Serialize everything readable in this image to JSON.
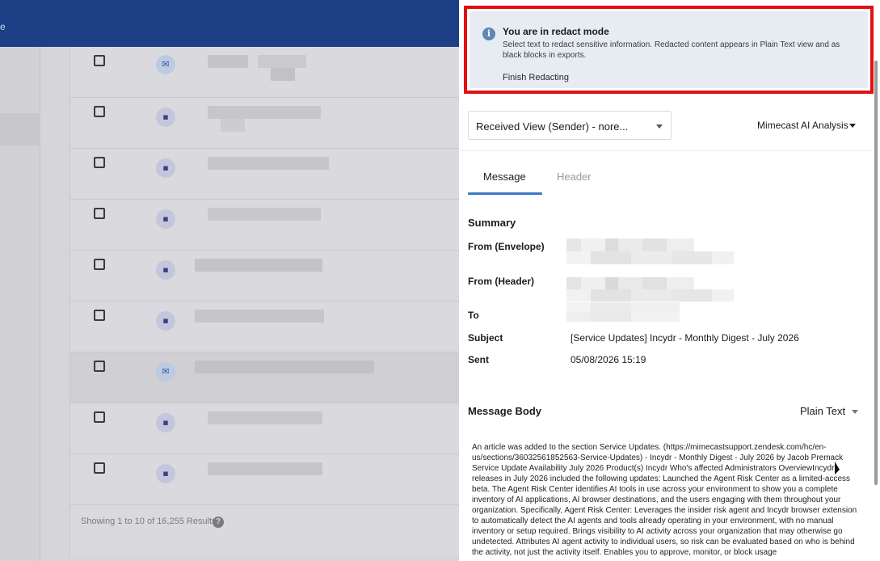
{
  "background": {
    "topbar_text": "e",
    "footer_text": "Showing 1 to 10 of 16,255 Results",
    "help_icon_glyph": "?",
    "rows": [
      {
        "icon": "envelope-icon",
        "glyph": "✉",
        "selected": false
      },
      {
        "icon": "chat-icon",
        "glyph": "▪",
        "selected": false
      },
      {
        "icon": "chat-icon",
        "glyph": "▪",
        "selected": false
      },
      {
        "icon": "chat-icon",
        "glyph": "▪",
        "selected": false
      },
      {
        "icon": "chat-icon",
        "glyph": "▪",
        "selected": false
      },
      {
        "icon": "chat-icon",
        "glyph": "▪",
        "selected": false
      },
      {
        "icon": "envelope-icon",
        "glyph": "✉",
        "selected": true
      },
      {
        "icon": "chat-icon",
        "glyph": "▪",
        "selected": false
      },
      {
        "icon": "chat-icon",
        "glyph": "▪",
        "selected": false
      }
    ]
  },
  "redact_banner": {
    "info_glyph": "i",
    "title": "You are in redact mode",
    "description": "Select text to redact sensitive information. Redacted content appears in Plain Text view and as black blocks in exports.",
    "finish_label": "Finish Redacting"
  },
  "toolbar": {
    "view_select_value": "Received View (Sender) - nore...",
    "ai_analysis_label": "Mimecast AI Analysis"
  },
  "tabs": [
    {
      "label": "Message",
      "active": true
    },
    {
      "label": "Header",
      "active": false
    }
  ],
  "summary": {
    "title": "Summary",
    "fields": [
      {
        "label": "From (Envelope)",
        "value": ""
      },
      {
        "label": "From (Header)",
        "value": ""
      },
      {
        "label": "To",
        "value": ""
      },
      {
        "label": "Subject",
        "value": "[Service Updates] Incydr - Monthly Digest - July 2026"
      },
      {
        "label": "Sent",
        "value": "05/08/2026 15:19"
      }
    ]
  },
  "message_body": {
    "title": "Message Body",
    "format_label": "Plain Text",
    "text": "An article was added to the section Service Updates. (https://mimecastsupport.zendesk.com/hc/en-us/sections/36032561852563-Service-Updates) - Incydr - Monthly Digest - July 2026 by Jacob Premack Service Update Availability July 2026 Product(s) Incydr Who's affected Administrators OverviewIncydr releases in July 2026 included the following updates: Launched the Agent Risk Center as a limited-access beta. The Agent Risk Center identifies AI tools in use across your environment to show you a complete inventory of AI applications, AI browser destinations, and the users engaging with them throughout your organization. Specifically, Agent Risk Center: Leverages the insider risk agent and Incydr browser extension to automatically detect the AI agents and tools already operating in your environment, with no manual inventory or setup required.  Brings visibility to AI activity across your organization that may otherwise go undetected. Attributes AI agent activity to individual users, so risk can be evaluated based on who is behind the activity, not just the activity itself. Enables you to approve, monitor, or block usage"
  },
  "colors": {
    "accent": "#3c78c6",
    "redact_border": "#e01010",
    "banner_bg": "#e6ecf2",
    "topbar": "#1c3f86"
  }
}
